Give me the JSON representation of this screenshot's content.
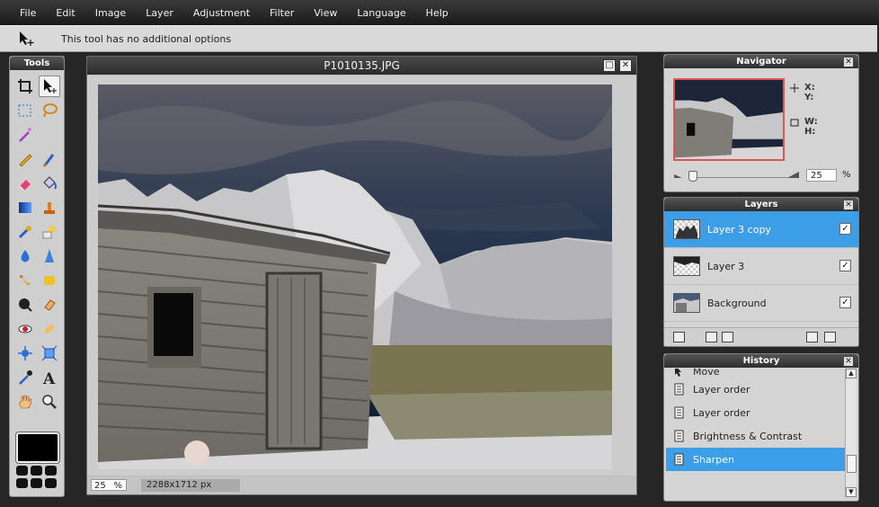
{
  "menu": [
    "File",
    "Edit",
    "Image",
    "Layer",
    "Adjustment",
    "Filter",
    "View",
    "Language",
    "Help"
  ],
  "options_bar": {
    "text": "This tool has no additional options",
    "tool_icon": "move-tool-icon"
  },
  "tools_panel": {
    "title": "Tools",
    "tools": [
      "crop-icon",
      "move-icon",
      "marquee-icon",
      "lasso-icon",
      "magic-wand-icon",
      "",
      "pencil-icon",
      "brush-icon",
      "eraser-icon",
      "paint-bucket-icon",
      "gradient-icon",
      "clone-stamp-icon",
      "color-replace-icon",
      "shapes-icon",
      "blur-icon",
      "sharpen-icon",
      "smudge-icon",
      "sponge-icon",
      "burn-icon",
      "dodge-icon",
      "red-eye-icon",
      "spot-heal-icon",
      "bloat-icon",
      "pinch-icon",
      "eyedropper-icon",
      "type-icon",
      "hand-icon",
      "zoom-icon"
    ],
    "foreground_color": "#000000"
  },
  "image_window": {
    "title": "P1010135.JPG",
    "zoom_value": "25",
    "zoom_unit": "%",
    "dimensions": "2288x1712 px"
  },
  "navigator": {
    "title": "Navigator",
    "x_label": "X:",
    "y_label": "Y:",
    "w_label": "W:",
    "h_label": "H:",
    "zoom": "25",
    "zoom_unit": "%"
  },
  "layers": {
    "title": "Layers",
    "items": [
      {
        "name": "Layer 3 copy",
        "selected": true,
        "visible": true
      },
      {
        "name": "Layer 3",
        "selected": false,
        "visible": true
      },
      {
        "name": "Background",
        "selected": false,
        "visible": true
      }
    ]
  },
  "history": {
    "title": "History",
    "items": [
      {
        "label": "Move",
        "icon": "move-icon"
      },
      {
        "label": "Layer order",
        "icon": "history-icon"
      },
      {
        "label": "Layer order",
        "icon": "history-icon"
      },
      {
        "label": "Brightness & Contrast",
        "icon": "history-icon"
      },
      {
        "label": "Sharpen",
        "icon": "history-icon",
        "selected": true
      }
    ]
  },
  "colors": {
    "accent": "#3d9ee8",
    "panel_header": "#3a3a3a",
    "nav_frame": "#dd5555"
  }
}
